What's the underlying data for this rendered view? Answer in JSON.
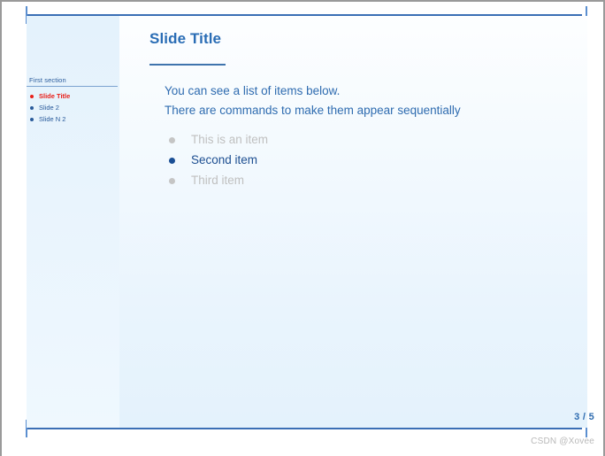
{
  "slide": {
    "frame_title": "Slide Title",
    "body_lines": [
      "You can see a list of items below.",
      "There are commands to make them appear sequentially"
    ],
    "items": [
      {
        "label": "This is an item",
        "state": "dimmed"
      },
      {
        "label": "Second item",
        "state": "highlighted"
      },
      {
        "label": "Third item",
        "state": "dimmed"
      }
    ]
  },
  "sidebar": {
    "section_label": "First section",
    "entries": [
      {
        "label": "Slide Title",
        "active": true
      },
      {
        "label": "Slide 2",
        "active": false
      },
      {
        "label": "Slide N 2",
        "active": false
      }
    ]
  },
  "footer": {
    "page_number": "3 / 5"
  },
  "watermark": {
    "text": "CSDN @Xovee"
  },
  "colors": {
    "title_blue": "#2a6db5",
    "body_blue": "#2f6cb0",
    "highlight_blue": "#1d4f91",
    "dimmed_gray": "#c0c0c0",
    "active_red": "#e8201a",
    "rule_blue": "#3b6fb5",
    "sidebar_bg": "#e8f4fc"
  }
}
